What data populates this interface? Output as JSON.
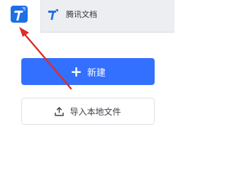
{
  "tabs": [
    {
      "label": "",
      "icon": "tencent-docs-logo-icon",
      "active": true
    },
    {
      "label": "腾讯文档",
      "icon": "tencent-docs-logo-icon",
      "active": false
    }
  ],
  "actions": {
    "new_label": "新建",
    "new_icon": "plus-icon",
    "import_label": "导入本地文件",
    "import_icon": "upload-icon"
  },
  "annotation": {
    "arrow_color": "#e02b26",
    "arrow_icon": "red-annotation-arrow"
  },
  "colors": {
    "accent": "#3370ff",
    "brand_blue": "#1d6fe6"
  }
}
